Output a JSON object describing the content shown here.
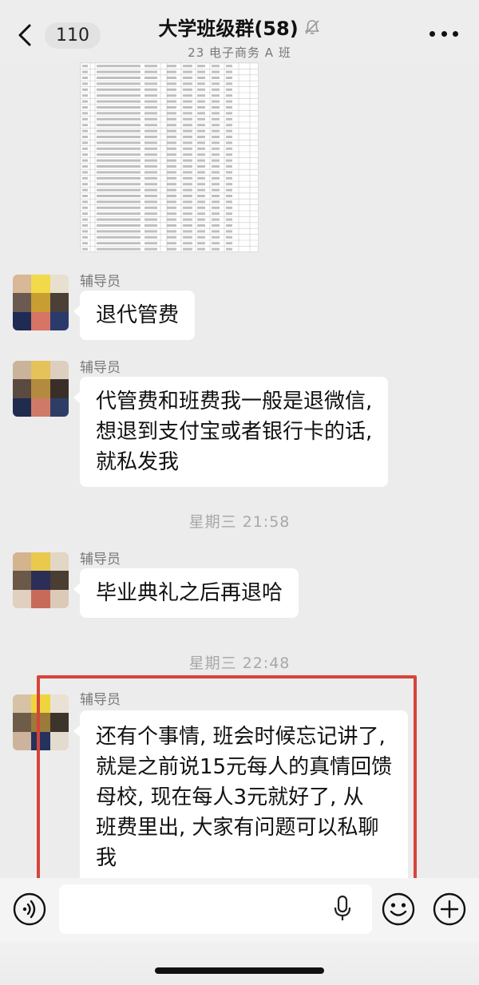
{
  "header": {
    "back_count": "110",
    "title": "大学班级群(58)",
    "subtitle": "23 电子商务 A 班"
  },
  "messages": [
    {
      "sender": "辅导员",
      "text": "退代管费"
    },
    {
      "sender": "辅导员",
      "lines": [
        "代管费和班费我一般是退微信,",
        "想退到支付宝或者银行卡的话,",
        "就私发我"
      ]
    },
    {
      "sender": "辅导员",
      "text": "毕业典礼之后再退哈"
    },
    {
      "sender": "辅导员",
      "lines": [
        "还有个事情, 班会时候忘记讲了,",
        "就是之前说15元每人的真情回馈",
        "母校, 现在每人3元就好了, 从",
        "班费里出, 大家有问题可以私聊",
        "我"
      ]
    }
  ],
  "timestamps": [
    "星期三 21:58",
    "星期三 22:48"
  ],
  "colors": {
    "annotation": "#d6443a",
    "bubble": "#ffffff",
    "background": "#ececec"
  },
  "icons": [
    "back-chevron-icon",
    "mute-bell-icon",
    "more-icon",
    "voice-icon",
    "mic-icon",
    "emoji-icon",
    "plus-icon"
  ]
}
